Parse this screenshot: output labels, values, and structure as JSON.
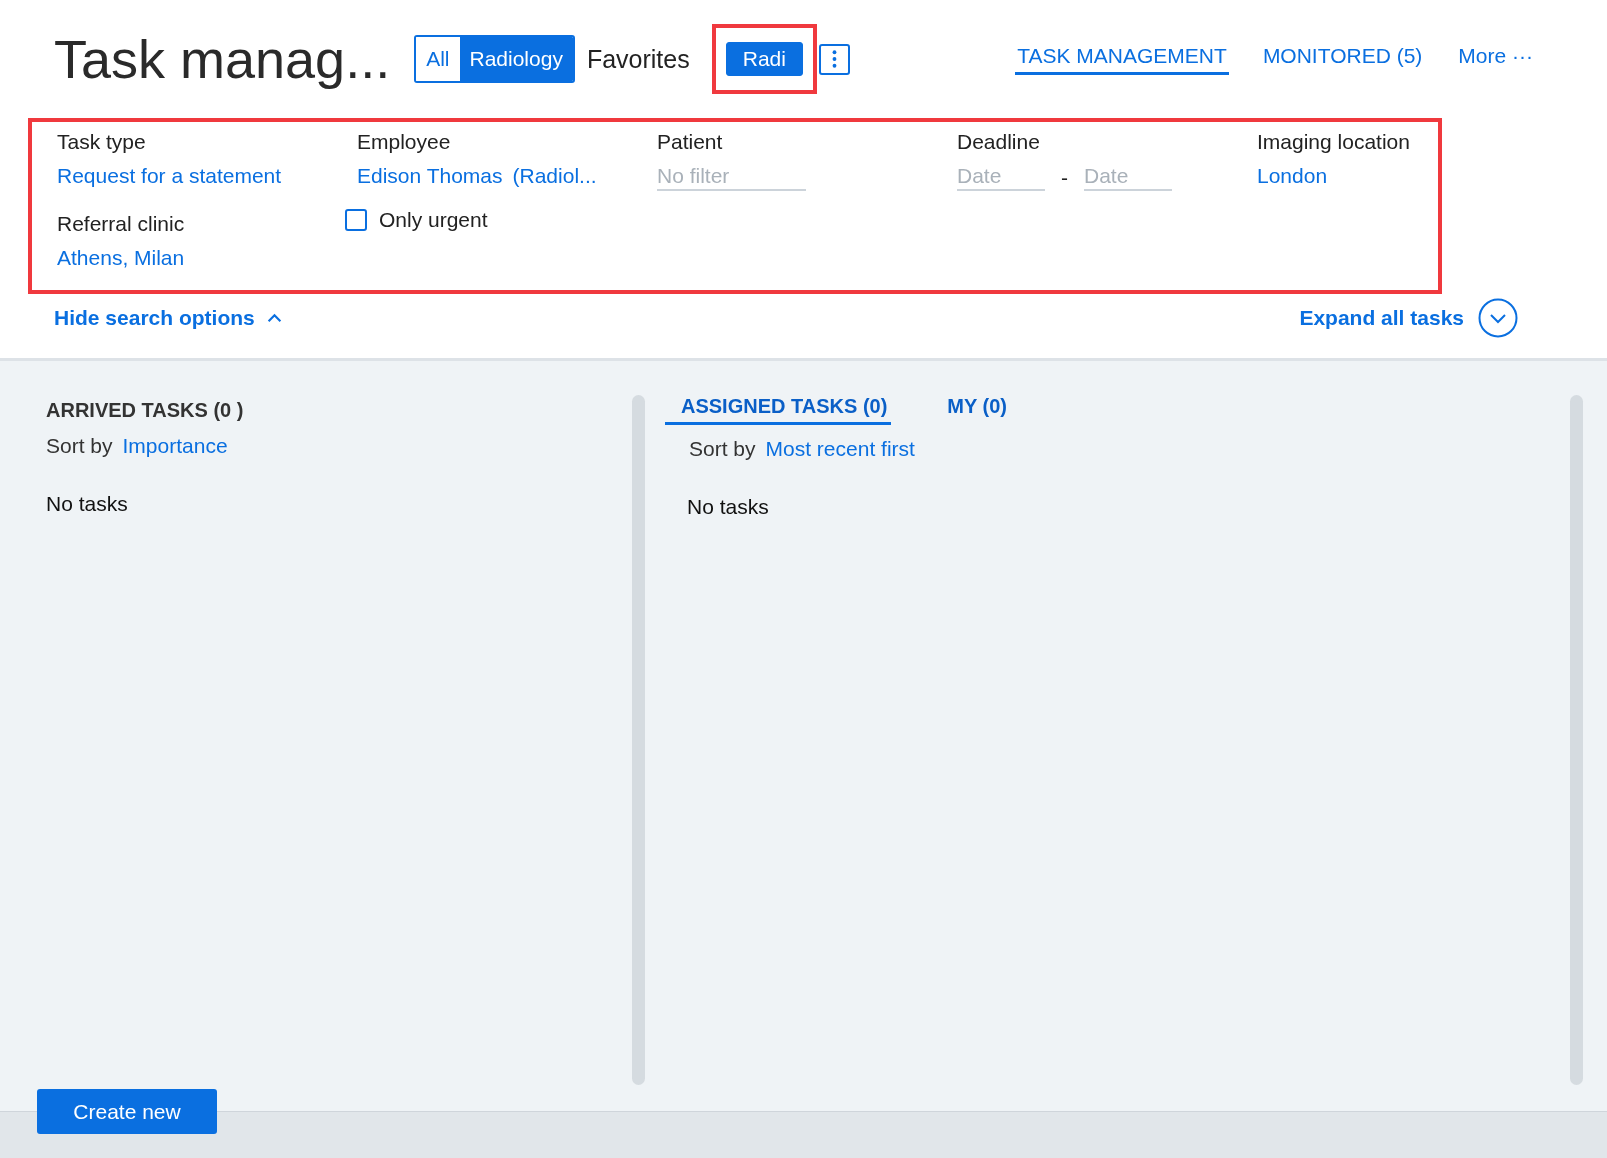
{
  "title": "Task manag...",
  "scope_toggle": [
    {
      "label": "All",
      "selected": false
    },
    {
      "label": "Radiology",
      "selected": true
    }
  ],
  "favorites_label": "Favorites",
  "favorite_chips": [
    {
      "label": "Radi",
      "selected": true,
      "highlighted": true
    }
  ],
  "nav_tabs": [
    {
      "label": "TASK MANAGEMENT",
      "selected": true
    },
    {
      "label": "MONITORED (5)",
      "selected": false
    },
    {
      "label": "More ···",
      "selected": false
    }
  ],
  "filters": {
    "highlighted": true,
    "fields": [
      {
        "kind": "link",
        "label": "Task type",
        "value": "Request for a statement"
      },
      {
        "kind": "link",
        "label": "Employee",
        "value": "Edison Thomas",
        "detail": "(Radiol..."
      },
      {
        "kind": "placeholder",
        "label": "Patient",
        "placeholder": "No filter"
      },
      {
        "kind": "date_range",
        "label": "Deadline",
        "from_placeholder": "Date",
        "separator": "-",
        "to_placeholder": "Date"
      },
      {
        "kind": "link",
        "label": "Imaging location",
        "value": "London"
      },
      {
        "kind": "link",
        "label": "Referral clinic",
        "value": "Athens, Milan"
      },
      {
        "kind": "checkbox",
        "label": "Only urgent",
        "checked": false
      }
    ]
  },
  "hide_search_options": "Hide search options",
  "expand_all_tasks": "Expand all tasks",
  "arrived": {
    "title": "ARRIVED TASKS (0 )",
    "sort_label": "Sort by",
    "sort_value": "Importance",
    "empty": "No tasks"
  },
  "assigned": {
    "tabs": [
      {
        "label": "ASSIGNED TASKS (0)",
        "selected": true
      },
      {
        "label": "MY (0)",
        "selected": false
      }
    ],
    "sort_label": "Sort by",
    "sort_value": "Most recent first",
    "empty": "No tasks"
  },
  "create_button": "Create new"
}
